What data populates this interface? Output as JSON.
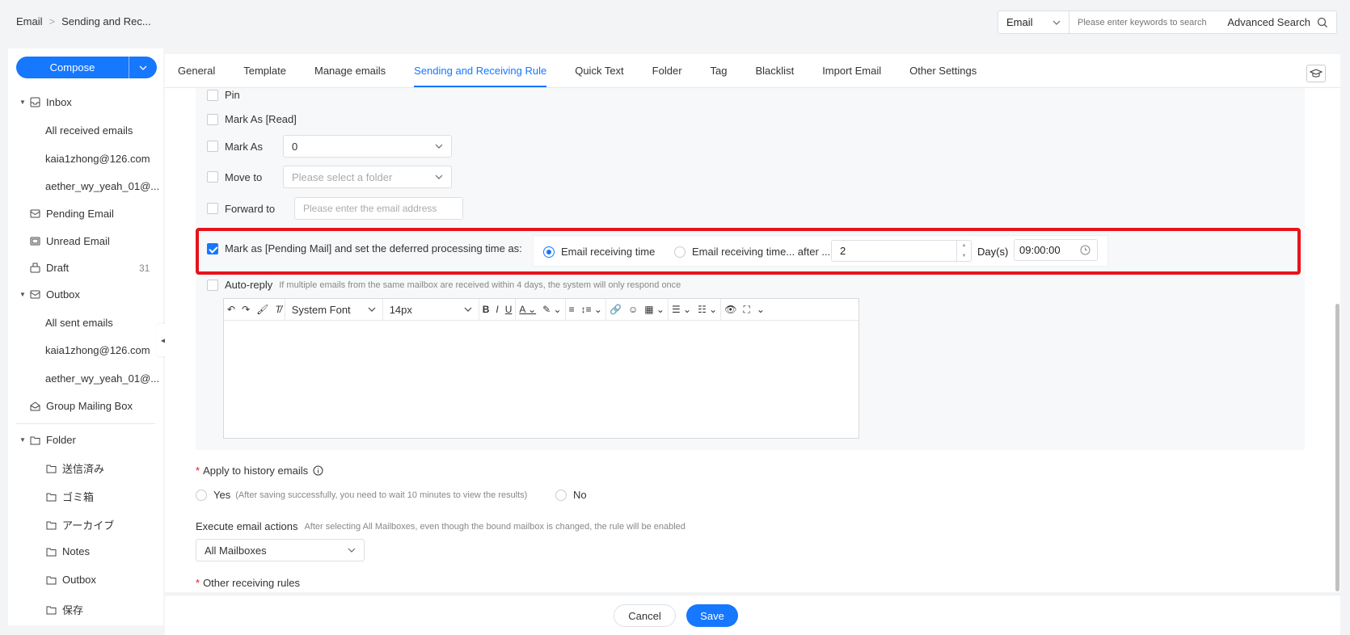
{
  "breadcrumb": {
    "root": "Email",
    "sep": ">",
    "current": "Sending and Rec..."
  },
  "search": {
    "type": "Email",
    "placeholder": "Please enter keywords to search",
    "advanced": "Advanced Search"
  },
  "compose": {
    "label": "Compose"
  },
  "sidebar": {
    "inbox": "Inbox",
    "all_received": "All received emails",
    "inbox_acct1": "kaia1zhong@126.com",
    "inbox_acct2": "aether_wy_yeah_01@...",
    "pending": "Pending Email",
    "unread": "Unread Email",
    "draft": "Draft",
    "draft_count": "31",
    "outbox": "Outbox",
    "all_sent": "All sent emails",
    "outbox_acct1": "kaia1zhong@126.com",
    "outbox_acct2": "aether_wy_yeah_01@...",
    "group": "Group Mailing Box",
    "folder": "Folder",
    "folders": [
      "送信済み",
      "ゴミ箱",
      "アーカイブ",
      "Notes",
      "Outbox",
      "保存"
    ]
  },
  "tabs": [
    "General",
    "Template",
    "Manage emails",
    "Sending and Receiving Rule",
    "Quick Text",
    "Folder",
    "Tag",
    "Blacklist",
    "Import Email",
    "Other Settings"
  ],
  "active_tab": "Sending and Receiving Rule",
  "actions": {
    "pin": "Pin",
    "mark_read": "Mark As [Read]",
    "mark_as": "Mark As",
    "mark_as_value": "0",
    "move_to": "Move to",
    "move_to_placeholder": "Please select a folder",
    "forward_to": "Forward to",
    "forward_placeholder": "Please enter the email address",
    "pending_label": "Mark as [Pending Mail] and set the deferred processing time as:",
    "radio_receiving": "Email receiving time",
    "radio_after": "Email receiving time... after ...",
    "days_value": "2",
    "days_unit": "Day(s)",
    "time_value": "09:00:00",
    "auto_reply": "Auto-reply",
    "auto_reply_hint": "If multiple emails from the same mailbox are received within 4 days, the system will only respond once"
  },
  "editor": {
    "font": "System Font",
    "size": "14px"
  },
  "history": {
    "label": "Apply to history emails",
    "yes": "Yes",
    "yes_hint": "(After saving successfully, you need to wait 10 minutes to view the results)",
    "no": "No"
  },
  "execute": {
    "label": "Execute email actions",
    "hint": "After selecting All Mailboxes, even though the bound mailbox is changed, the rule will be enabled",
    "value": "All Mailboxes"
  },
  "other_rules": {
    "label": "Other receiving rules"
  },
  "footer": {
    "cancel": "Cancel",
    "save": "Save"
  },
  "colors": {
    "accent": "#1677ff",
    "highlight": "#e5141b"
  }
}
